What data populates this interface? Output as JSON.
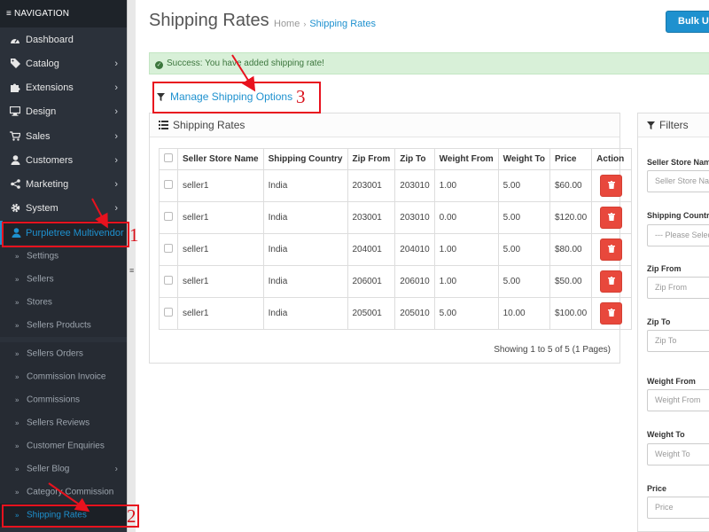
{
  "sidebar": {
    "header": "≡ NAVIGATION",
    "menu": [
      {
        "label": "Dashboard",
        "icon": "dashboard-icon",
        "chevron": false
      },
      {
        "label": "Catalog",
        "icon": "tag-icon",
        "chevron": true
      },
      {
        "label": "Extensions",
        "icon": "puzzle-icon",
        "chevron": true
      },
      {
        "label": "Design",
        "icon": "desktop-icon",
        "chevron": true
      },
      {
        "label": "Sales",
        "icon": "cart-icon",
        "chevron": true
      },
      {
        "label": "Customers",
        "icon": "user-icon",
        "chevron": true
      },
      {
        "label": "Marketing",
        "icon": "share-icon",
        "chevron": true
      },
      {
        "label": "System",
        "icon": "gear-icon",
        "chevron": true
      },
      {
        "label": "Purpletree Multivendor",
        "icon": "user-icon",
        "chevron": false
      }
    ],
    "submenu": [
      {
        "label": "Settings",
        "chevron": false
      },
      {
        "label": "Sellers",
        "chevron": false
      },
      {
        "label": "Stores",
        "chevron": false
      },
      {
        "label": "Sellers Products",
        "chevron": false
      },
      {
        "label": "Sellers Orders",
        "chevron": false
      },
      {
        "label": "Commission Invoice",
        "chevron": false
      },
      {
        "label": "Commissions",
        "chevron": false
      },
      {
        "label": "Sellers Reviews",
        "chevron": false
      },
      {
        "label": "Customer Enquiries",
        "chevron": false
      },
      {
        "label": "Seller Blog",
        "chevron": true
      },
      {
        "label": "Category Commission",
        "chevron": false
      },
      {
        "label": "Shipping Rates",
        "chevron": false
      }
    ]
  },
  "header": {
    "title": "Shipping Rates",
    "breadcrumb": [
      "Home",
      "Shipping Rates"
    ],
    "bulk_upload_label": "Bulk Uplo"
  },
  "alert": {
    "text": "Success: You have added shipping rate!"
  },
  "manage_options_label": "Manage Shipping Options",
  "rates_panel": {
    "title": "Shipping Rates",
    "columns": [
      "Seller Store Name",
      "Shipping Country",
      "Zip From",
      "Zip To",
      "Weight From",
      "Weight To",
      "Price",
      "Action"
    ],
    "rows": [
      [
        "seller1",
        "India",
        "203001",
        "203010",
        "1.00",
        "5.00",
        "$60.00"
      ],
      [
        "seller1",
        "India",
        "203001",
        "203010",
        "0.00",
        "5.00",
        "$120.00"
      ],
      [
        "seller1",
        "India",
        "204001",
        "204010",
        "1.00",
        "5.00",
        "$80.00"
      ],
      [
        "seller1",
        "India",
        "206001",
        "206010",
        "1.00",
        "5.00",
        "$50.00"
      ],
      [
        "seller1",
        "India",
        "205001",
        "205010",
        "5.00",
        "10.00",
        "$100.00"
      ]
    ],
    "pagination": "Showing 1 to 5 of 5 (1 Pages)"
  },
  "filters": {
    "title": "Filters",
    "fields": [
      {
        "label": "Seller Store Nam",
        "placeholder": "Seller Store Nam"
      },
      {
        "label": "Shipping Countr",
        "placeholder": "--- Please Selec"
      },
      {
        "label": "Zip From",
        "placeholder": "Zip From"
      },
      {
        "label": "Zip To",
        "placeholder": "Zip To"
      },
      {
        "label": "Weight From",
        "placeholder": "Weight From"
      },
      {
        "label": "Weight To",
        "placeholder": "Weight To"
      },
      {
        "label": "Price",
        "placeholder": "Price"
      }
    ]
  },
  "annotations": [
    "1",
    "2",
    "3"
  ],
  "colors": {
    "accent": "#1e91cf",
    "sidebar_bg": "#2b313a",
    "danger": "#e8483c",
    "success_bg": "#d8f0d8",
    "annotation": "#e8121e"
  }
}
